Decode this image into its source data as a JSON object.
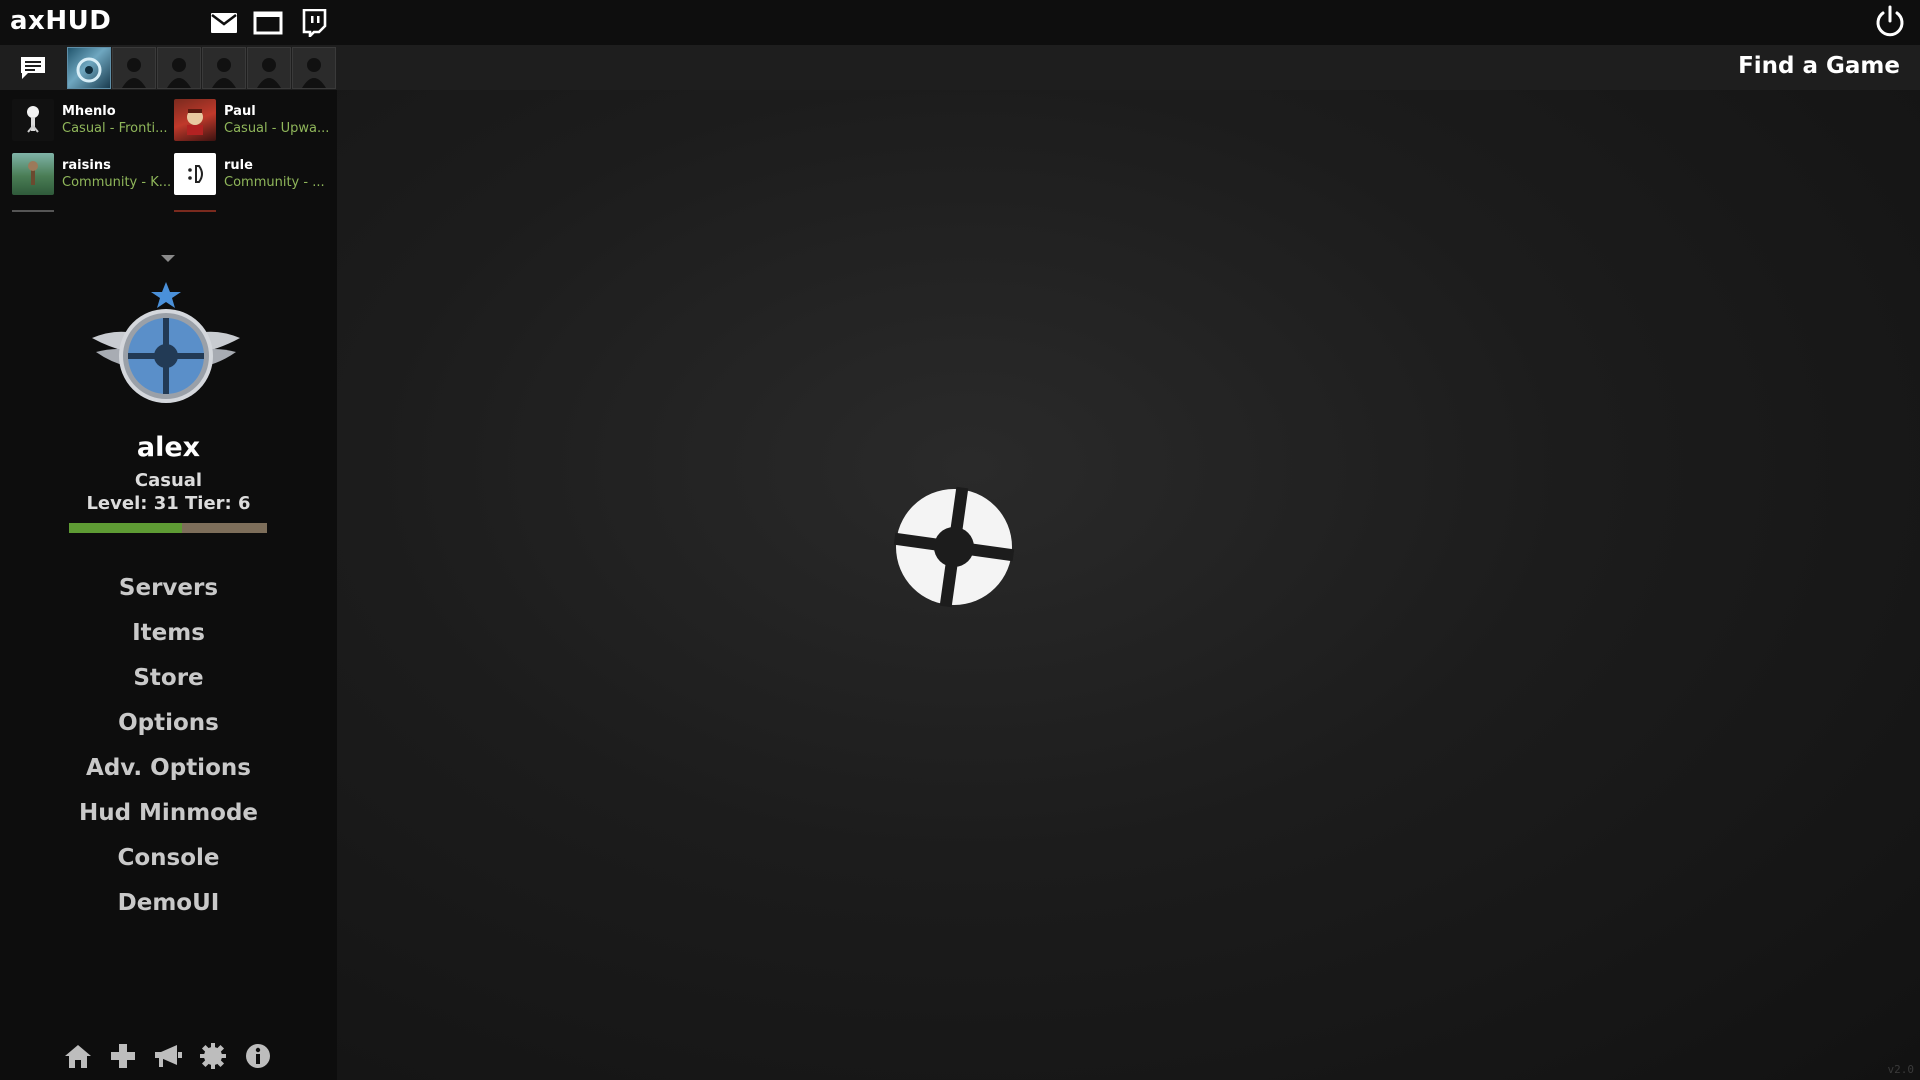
{
  "app": {
    "title": "axHUD"
  },
  "topbar": {
    "icons": [
      "mail-icon",
      "window-icon",
      "twitch-icon"
    ],
    "power_icon": "power-icon"
  },
  "subbar": {
    "chat_icon": "chat-icon",
    "party_slots": 6,
    "find_game_label": "Find a Game"
  },
  "friends": [
    {
      "name": "Mhenlo",
      "status": "Casual - Fronti..."
    },
    {
      "name": "Paul",
      "status": "Casual - Upwa..."
    },
    {
      "name": "raisins",
      "status": "Community - K..."
    },
    {
      "name": "rule",
      "status": "Community - ..."
    }
  ],
  "profile": {
    "username": "alex",
    "mode": "Casual",
    "level_text": "Level: 31 Tier: 6",
    "xp_progress": 0.57
  },
  "menu": {
    "items": [
      "Servers",
      "Items",
      "Store",
      "Options",
      "Adv. Options",
      "Hud Minmode",
      "Console",
      "DemoUI"
    ]
  },
  "bottom_icons": [
    "home-icon",
    "plus-icon",
    "megaphone-icon",
    "gear-icon",
    "info-icon"
  ],
  "colors": {
    "accent_green": "#5e9b34",
    "friend_status": "#8fb65a",
    "background": "#151515"
  },
  "version": "v2.0"
}
